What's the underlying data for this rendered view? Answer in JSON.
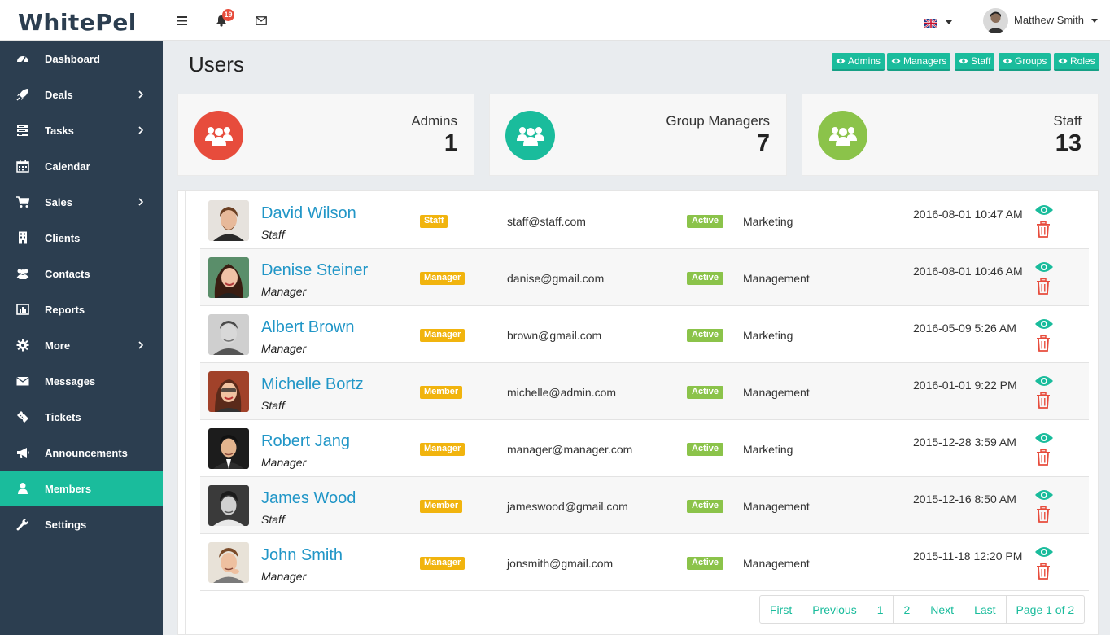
{
  "app": {
    "logo": "WhitePel"
  },
  "topbar": {
    "notification_count": "19",
    "user_name": "Matthew Smith"
  },
  "sidebar": {
    "items": [
      {
        "label": "Dashboard",
        "icon": "dashboard-icon",
        "has_children": false
      },
      {
        "label": "Deals",
        "icon": "rocket-icon",
        "has_children": true
      },
      {
        "label": "Tasks",
        "icon": "tasks-icon",
        "has_children": true
      },
      {
        "label": "Calendar",
        "icon": "calendar-icon",
        "has_children": false
      },
      {
        "label": "Sales",
        "icon": "cart-icon",
        "has_children": true
      },
      {
        "label": "Clients",
        "icon": "building-icon",
        "has_children": false
      },
      {
        "label": "Contacts",
        "icon": "users-icon",
        "has_children": false
      },
      {
        "label": "Reports",
        "icon": "bar-chart-icon",
        "has_children": false
      },
      {
        "label": "More",
        "icon": "gear-icon",
        "has_children": true
      },
      {
        "label": "Messages",
        "icon": "envelope-icon",
        "has_children": false
      },
      {
        "label": "Tickets",
        "icon": "ticket-icon",
        "has_children": false
      },
      {
        "label": "Announcements",
        "icon": "megaphone-icon",
        "has_children": false
      },
      {
        "label": "Members",
        "icon": "user-icon",
        "has_children": false,
        "active": true
      },
      {
        "label": "Settings",
        "icon": "wrench-icon",
        "has_children": false
      }
    ]
  },
  "page": {
    "title": "Users",
    "filters": [
      "Admins",
      "Managers",
      "Staff",
      "Groups",
      "Roles"
    ]
  },
  "stats": [
    {
      "label": "Admins",
      "value": "1",
      "color": "#e74c3c"
    },
    {
      "label": "Group Managers",
      "value": "7",
      "color": "#1abc9c"
    },
    {
      "label": "Staff",
      "value": "13",
      "color": "#8bc34a"
    }
  ],
  "users": [
    {
      "name": "David Wilson",
      "role": "Staff",
      "badge": "Staff",
      "email": "staff@staff.com",
      "status": "Active",
      "department": "Marketing",
      "date": "2016-08-01 10:47 AM"
    },
    {
      "name": "Denise Steiner",
      "role": "Manager",
      "badge": "Manager",
      "email": "danise@gmail.com",
      "status": "Active",
      "department": "Management",
      "date": "2016-08-01 10:46 AM"
    },
    {
      "name": "Albert Brown",
      "role": "Manager",
      "badge": "Manager",
      "email": "brown@gmail.com",
      "status": "Active",
      "department": "Marketing",
      "date": "2016-05-09 5:26 AM"
    },
    {
      "name": "Michelle Bortz",
      "role": "Staff",
      "badge": "Member",
      "email": "michelle@admin.com",
      "status": "Active",
      "department": "Management",
      "date": "2016-01-01 9:22 PM"
    },
    {
      "name": "Robert Jang",
      "role": "Manager",
      "badge": "Manager",
      "email": "manager@manager.com",
      "status": "Active",
      "department": "Marketing",
      "date": "2015-12-28 3:59 AM"
    },
    {
      "name": "James Wood",
      "role": "Staff",
      "badge": "Member",
      "email": "jameswood@gmail.com",
      "status": "Active",
      "department": "Management",
      "date": "2015-12-16 8:50 AM"
    },
    {
      "name": "John Smith",
      "role": "Manager",
      "badge": "Manager",
      "email": "jonsmith@gmail.com",
      "status": "Active",
      "department": "Management",
      "date": "2015-11-18 12:20 PM"
    }
  ],
  "pagination": {
    "first": "First",
    "previous": "Previous",
    "pages": [
      "1",
      "2"
    ],
    "next": "Next",
    "last": "Last",
    "summary": "Page 1 of 2"
  },
  "colors": {
    "sidebar_bg": "#2c3e50",
    "accent": "#1abc9c",
    "link": "#2196c7",
    "badge_role": "#f1b40e",
    "badge_status": "#8bc34a",
    "danger": "#e74c3c"
  }
}
